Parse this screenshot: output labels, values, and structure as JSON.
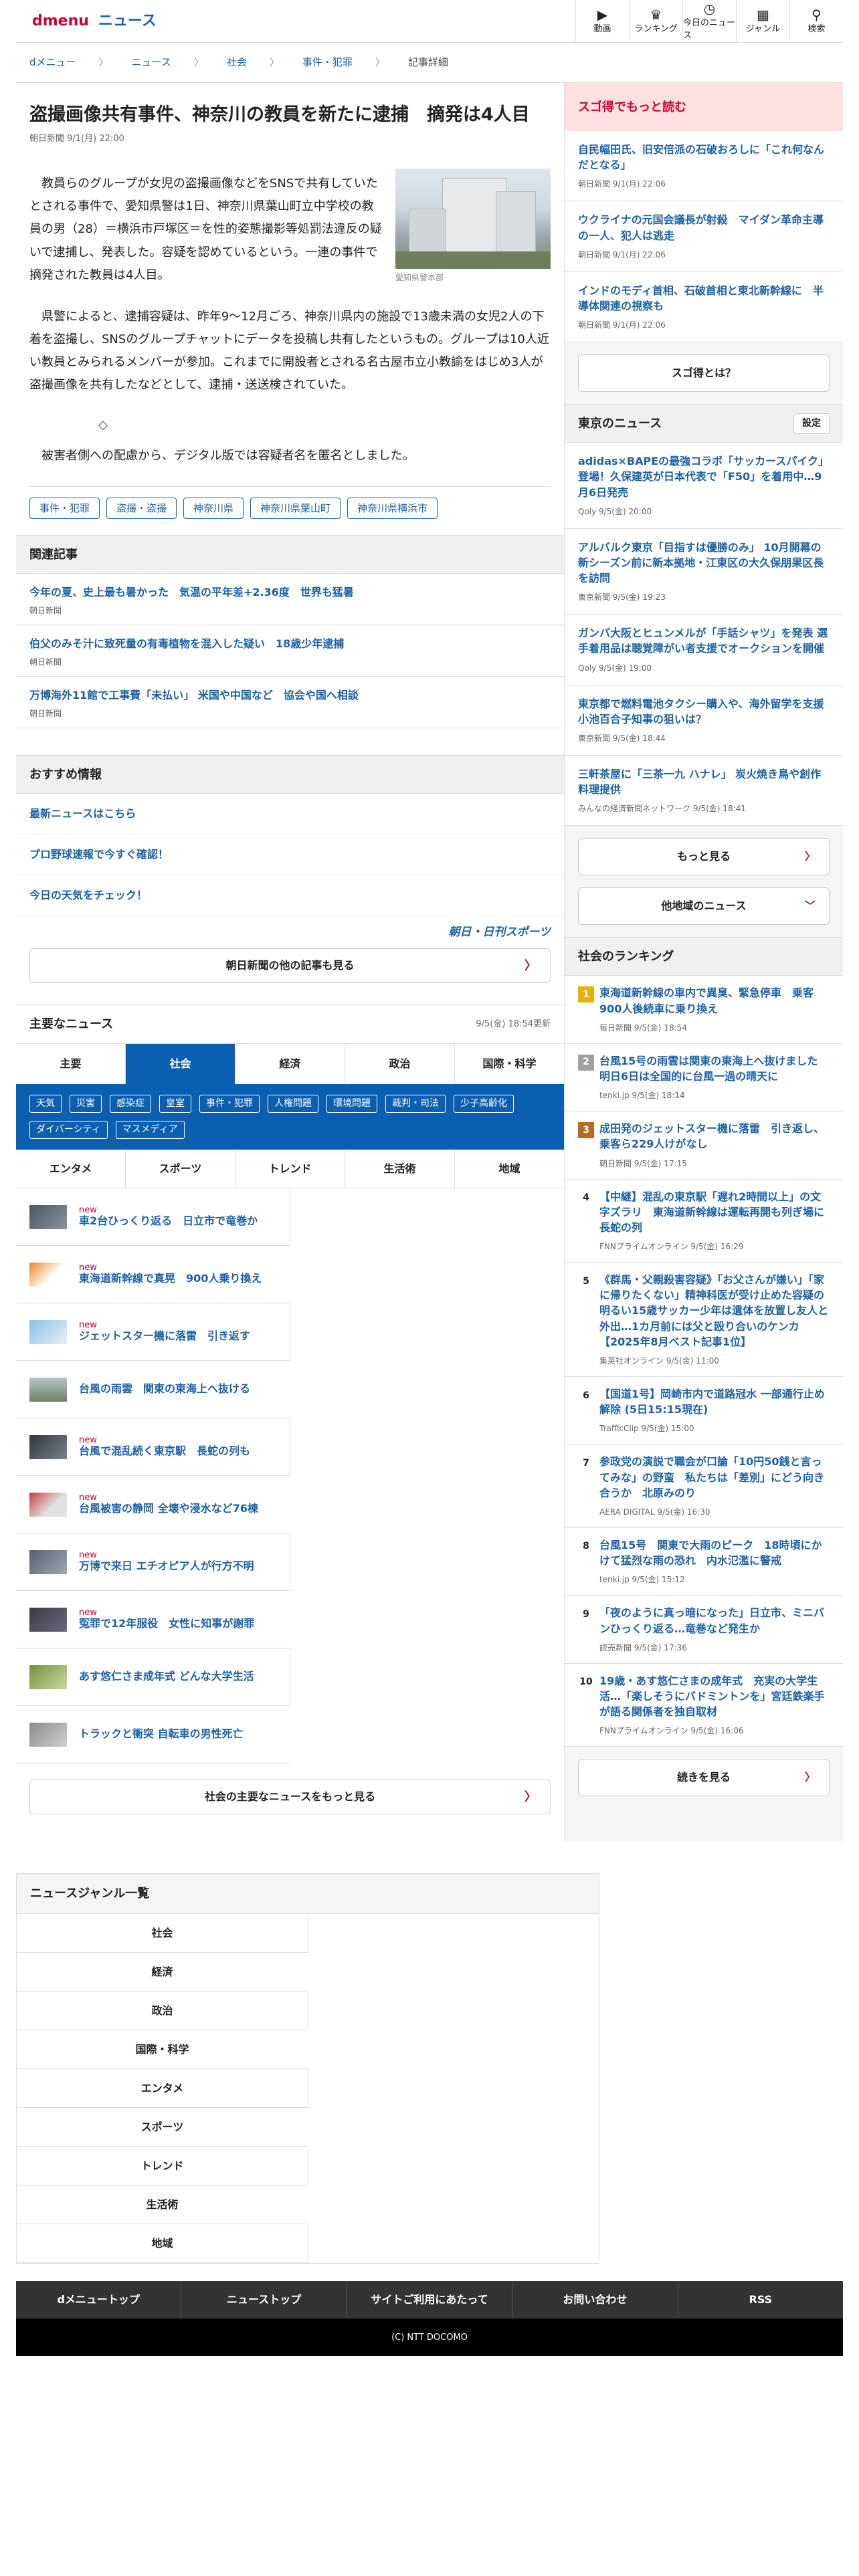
{
  "header": {
    "logo_d": "dmenu",
    "logo_news": "ニュース",
    "nav": [
      {
        "label": "動画",
        "icon": "video-icon"
      },
      {
        "label": "ランキング",
        "icon": "trophy-icon"
      },
      {
        "label": "今日のニュース",
        "icon": "clock-icon"
      },
      {
        "label": "ジャンル",
        "icon": "grid-icon"
      },
      {
        "label": "検索",
        "icon": "search-icon"
      }
    ]
  },
  "breadcrumb": [
    "dメニュー",
    "ニュース",
    "社会",
    "事件・犯罪",
    "記事詳細"
  ],
  "article": {
    "title": "盗撮画像共有事件、神奈川の教員を新たに逮捕　摘発は4人目",
    "date": "朝日新聞 9/1(月) 22:00",
    "photo_caption": "愛知県警本部",
    "paragraphs": [
      "教員らのグループが女児の盗撮画像などをSNSで共有していたとされる事件で、愛知県警は1日、神奈川県葉山町立中学校の教員の男（28）＝横浜市戸塚区＝を性的姿態撮影等処罰法違反の疑いで逮捕し、発表した。容疑を認めているという。一連の事件で摘発された教員は4人目。",
      "県警によると、逮捕容疑は、昨年9～12月ごろ、神奈川県内の施設で13歳未満の女児2人の下着を盗撮し、SNSのグループチャットにデータを投稿し共有したというもの。グループは10人近い教員とみられるメンバーが参加。これまでに開設者とされる名古屋市立小教諭をはじめ3人が盗撮画像を共有したなどとして、逮捕・送送検されていた。",
      "被害者側への配慮から、デジタル版では容疑者名を匿名としました。"
    ],
    "divider_mark": "◇",
    "tags": [
      "事件・犯罪",
      "盗撮・盗撮",
      "神奈川県",
      "神奈川県葉山町",
      "神奈川県横浜市"
    ]
  },
  "related": {
    "heading": "関連記事",
    "items": [
      {
        "title": "今年の夏、史上最も暑かった　気温の平年差+2.36度　世界も猛暑",
        "source": "朝日新聞"
      },
      {
        "title": "伯父のみそ汁に致死量の有毒植物を混入した疑い　18歳少年逮捕",
        "source": "朝日新聞"
      },
      {
        "title": "万博海外11館で工事費「未払い」 米国や中国など　協会や国へ相談",
        "source": "朝日新聞"
      }
    ]
  },
  "recommend": {
    "heading": "おすすめ情報",
    "items": [
      "最新ニュースはこちら",
      "プロ野球速報で今すぐ確認！",
      "今日の天気をチェック！"
    ],
    "sports_logo": "朝日・日刊スポーツ",
    "more_btn": "朝日新聞の他の記事も見る"
  },
  "main_news": {
    "heading": "主要なニュース",
    "updated": "9/5(金) 18:54更新",
    "tabs1": [
      "主要",
      "社会",
      "経済",
      "政治",
      "国際・科学"
    ],
    "active_tab": "社会",
    "subcats": [
      "天気",
      "災害",
      "感染症",
      "皇室",
      "事件・犯罪",
      "人権問題",
      "環境問題",
      "裁判・司法",
      "少子高齢化",
      "ダイバーシティ",
      "マスメディア"
    ],
    "tabs2": [
      "エンタメ",
      "スポーツ",
      "トレンド",
      "生活術",
      "地域"
    ],
    "items": [
      {
        "new": "new",
        "title": "車2台ひっくり返る　日立市で竜巻か"
      },
      {
        "new": "new",
        "title": "東海道新幹線で真晃　900人乗り換え"
      },
      {
        "new": "new",
        "title": "ジェットスター機に落雷　引き返す"
      },
      {
        "new": "",
        "title": "台風の雨雲　関東の東海上へ抜ける"
      },
      {
        "new": "new",
        "title": "台風で混乱続く東京駅　長蛇の列も"
      },
      {
        "new": "new",
        "title": "台風被害の静岡 全壊や浸水など76棟"
      },
      {
        "new": "new",
        "title": "万博で来日 エチオピア人が行方不明"
      },
      {
        "new": "new",
        "title": "冤罪で12年服役　女性に知事が謝罪"
      },
      {
        "new": "",
        "title": "あす悠仁さま成年式 どんな大学生活"
      },
      {
        "new": "",
        "title": "トラックと衝突 自転車の男性死亡"
      }
    ],
    "more_btn": "社会の主要なニュースをもっと見る"
  },
  "side": {
    "sugo_heading": "スゴ得でもっと読む",
    "sugo_items": [
      {
        "title": "自民幅田氏、旧安倍派の石破おろしに「これ何なんだとなる」",
        "source": "朝日新聞 9/1(月) 22:06"
      },
      {
        "title": "ウクライナの元国会議長が射殺　マイダン革命主導の一人、犯人は逃走",
        "source": "朝日新聞 9/1(月) 22:06"
      },
      {
        "title": "インドのモディ首相、石破首相と東北新幹線に　半導体関連の視察も",
        "source": "朝日新聞 9/1(月) 22:06"
      }
    ],
    "sugo_btn": "スゴ得とは？",
    "tokyo_heading": "東京のニュース",
    "settings_btn": "設定",
    "tokyo_items": [
      {
        "title": "adidas×BAPEの最強コラボ「サッカースパイク」登場！久保建英が日本代表で「F50」を着用中…9月6日発売",
        "source": "Qoly 9/5(金) 20:00"
      },
      {
        "title": "アルバルク東京「目指すは優勝のみ」 10月開幕の新シーズン前に新本拠地・江東区の大久保朋果区長を訪問",
        "source": "東京新聞 9/5(金) 19:23"
      },
      {
        "title": "ガンバ大阪とヒュンメルが「手話シャツ」を発表 選手着用品は聴覚障がい者支援でオークションを開催",
        "source": "Qoly 9/5(金) 19:00"
      },
      {
        "title": "東京都で燃料電池タクシー購入や、海外留学を支援　小池百合子知事の狙いは？",
        "source": "東京新聞 9/5(金) 18:44"
      },
      {
        "title": "三軒茶屋に「三茶一九 ハナレ」 炭火焼き鳥や創作料理提供",
        "source": "みんなの経済新聞ネットワーク 9/5(金) 18:41"
      }
    ],
    "tokyo_more": "もっと見る",
    "tokyo_other": "他地域のニュース",
    "rank_heading": "社会のランキング",
    "rank_items": [
      {
        "n": "1",
        "title": "東海道新幹線の車内で異臭、緊急停車　乗客900人後続車に乗り換え",
        "source": "毎日新聞 9/5(金) 18:54"
      },
      {
        "n": "2",
        "title": "台風15号の雨雲は関東の東海上へ抜けました 明日6日は全国的に台風一過の晴天に",
        "source": "tenki.jp 9/5(金) 18:14"
      },
      {
        "n": "3",
        "title": "成田発のジェットスター機に落雷　引き返し、乗客ら229人けがなし",
        "source": "朝日新聞 9/5(金) 17:15"
      },
      {
        "n": "4",
        "title": "【中継】混乱の東京駅「遅れ2時間以上」の文字ズラリ　東海道新幹線は運転再開も列ぎ場に長蛇の列",
        "source": "FNNプライムオンライン 9/5(金) 16:29"
      },
      {
        "n": "5",
        "title": "《群馬・父親殺害容疑》「お父さんが嫌い」「家に帰りたくない」精神科医が受け止めた容疑の明るい15歳サッカー少年は遺体を放置し友人と外出…1カ月前には父と殴り合いのケンカ【2025年8月ベスト記事1位】",
        "source": "集英社オンライン 9/5(金) 11:00"
      },
      {
        "n": "6",
        "title": "【国道1号】岡崎市内で道路冠水 一部通行止め解除 (5日15:15現在)",
        "source": "TrafficClip 9/5(金) 15:00"
      },
      {
        "n": "7",
        "title": "参政党の演説で職会が口論「10円50銭と言ってみな」の野蛮　私たちは「差別」にどう向き合うか　北原みのり",
        "source": "AERA DIGITAL 9/5(金) 16:30"
      },
      {
        "n": "8",
        "title": "台風15号　関東で大雨のピーク　18時頃にかけて猛烈な雨の恐れ　内水氾濫に警戒",
        "source": "tenki.jp 9/5(金) 15:12"
      },
      {
        "n": "9",
        "title": "「夜のように真っ暗になった」日立市、ミニバンひっくり返る…竜巻など発生か",
        "source": "読売新聞 9/5(金) 17:36"
      },
      {
        "n": "10",
        "title": "19歳・あす悠仁さまの成年式　充実の大学生活…「楽しそうにバドミントンを」宮廷鉄楽手が語る関係者を独自取材",
        "source": "FNNプライムオンライン 9/5(金) 16:06"
      }
    ],
    "rank_more": "続きを見る"
  },
  "genre": {
    "heading": "ニュースジャンル一覧",
    "items": [
      "社会",
      "経済",
      "政治",
      "国際・科学",
      "エンタメ",
      "スポーツ",
      "トレンド",
      "生活術",
      "地域"
    ]
  },
  "footer": {
    "links": [
      "dメニュートップ",
      "ニューストップ",
      "サイトご利用にあたって",
      "お問い合わせ",
      "RSS"
    ],
    "copyright": "(C) NTT DOCOMO"
  },
  "colors": {
    "brand_red": "#cc0033",
    "link_blue": "#1d62a6",
    "tab_blue": "#0b5fb0",
    "rank_gold": "#e8b000"
  }
}
